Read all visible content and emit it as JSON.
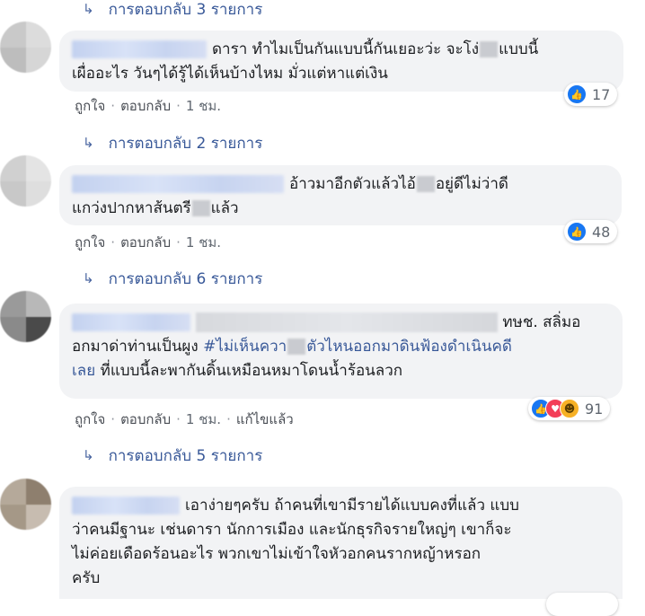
{
  "reply_links": [
    {
      "label": "การตอบกลับ 3 รายการ"
    },
    {
      "label": "การตอบกลับ 2 รายการ"
    },
    {
      "label": "การตอบกลับ 6 รายการ"
    },
    {
      "label": "การตอบกลับ 5 รายการ"
    }
  ],
  "comments": [
    {
      "line1": "ดารา ทำไมเป็นกันแบบนี้กันเยอะว่ะ จะโง่",
      "line1b": "แบบนี้",
      "line2": "เผื่ออะไร วันๆได้รู้ได้เห็นบ้างไหม มั่วแต่หาแต่เงิน",
      "like_label": "ถูกใจ",
      "reply_label": "ตอบกลับ",
      "time": "1 ชม.",
      "reaction_count": "17"
    },
    {
      "line1": "อ้าวมาอีกตัวแล้วไอ้",
      "line1b": "อยู่ดีไม่ว่าดี",
      "line2": "แกว่งปากหาส้นตรี",
      "line2b": "แล้ว",
      "like_label": "ถูกใจ",
      "reply_label": "ตอบกลับ",
      "time": "1 ชม.",
      "reaction_count": "48"
    },
    {
      "line1_tail": "ทษช. สลิ่มอ",
      "line2a": "อกมาด่าท่านเป็นผูง",
      "hashtag_a": "#ไม่เห็นควา",
      "hashtag_b": "ตัวไหนออกมาดินฟ้องดำเนินคดี",
      "line3a": "เลย",
      "line3b": "ที่แบบนี้ละพากันดิ้นเหมือนหมาโดนน้ำร้อนลวก",
      "like_label": "ถูกใจ",
      "reply_label": "ตอบกลับ",
      "time": "1 ชม.",
      "edited_label": "แก้ไขแล้ว",
      "reaction_count": "91"
    },
    {
      "line1": "เอาง่ายๆครับ ถ้าคนที่เขามีรายได้แบบคงที่แล้ว แบบ",
      "line2": "ว่าคนมีฐานะ เช่นดารา นักการเมือง และนักธุรกิจรายใหญ่ๆ เขาก็จะ",
      "line3": "ไม่ค่อยเดือดร้อนอะไร พวกเขาไม่เข้าใจหัวอกคนรากหญ้าหรอก",
      "line4": "ครับ"
    }
  ],
  "colors": {
    "link": "#385898",
    "bubble_bg": "#f2f3f5",
    "like_blue": "#1877f2",
    "love_red": "#f33e58",
    "haha_yellow": "#f7b125"
  },
  "icons": {
    "reply_arrow": "reply-arrow-icon",
    "like": "like-reaction-icon",
    "love": "love-reaction-icon",
    "haha": "haha-reaction-icon"
  }
}
